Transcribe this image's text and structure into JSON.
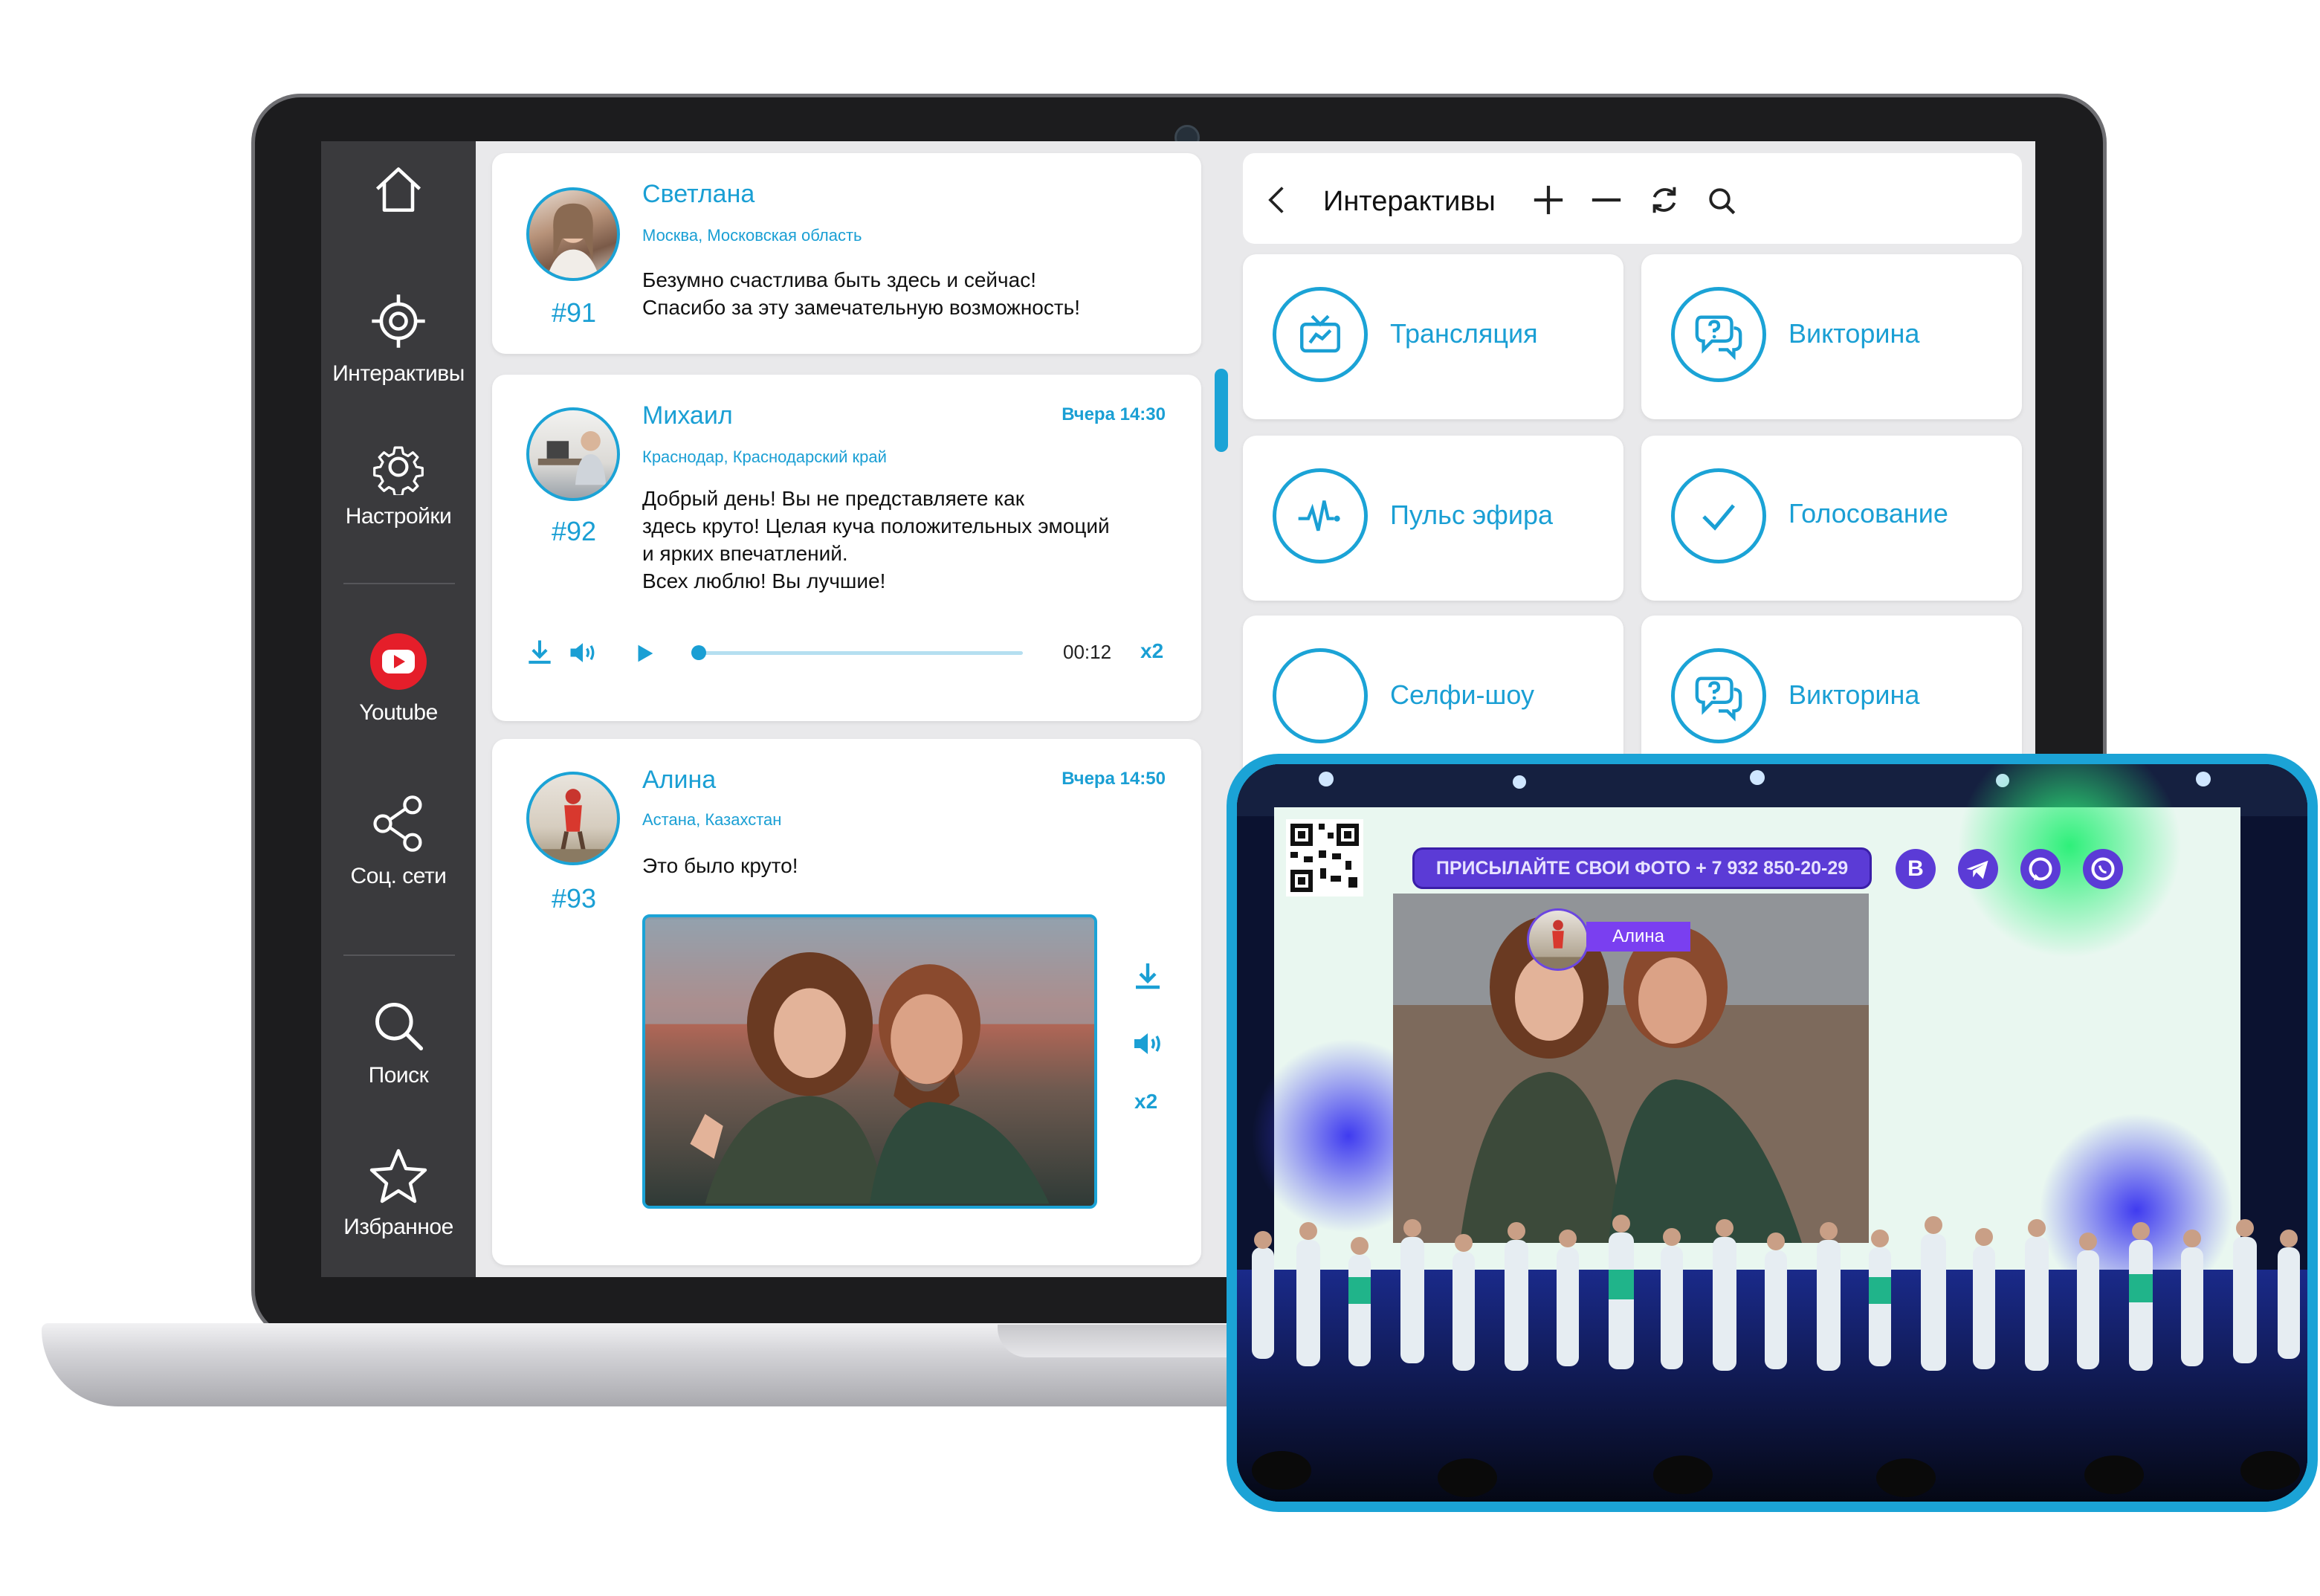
{
  "sidebar": {
    "items": [
      {
        "label": "",
        "icon": "home-icon"
      },
      {
        "label": "Интерактивы",
        "icon": "target-icon"
      },
      {
        "label": "Настройки",
        "icon": "gear-icon"
      },
      {
        "label": "Youtube",
        "icon": "youtube-icon"
      },
      {
        "label": "Соц. сети",
        "icon": "share-icon"
      },
      {
        "label": "Поиск",
        "icon": "search-icon"
      },
      {
        "label": "Избранное",
        "icon": "star-icon"
      }
    ]
  },
  "feed": {
    "posts": [
      {
        "name": "Светлана",
        "location": "Москва, Московская область",
        "number": "#91",
        "time": "",
        "text": "Безумно счастлива быть здесь и сейчас!\nСпасибо за эту замечательную возможность!"
      },
      {
        "name": "Михаил",
        "location": "Краснодар, Краснодарский край",
        "number": "#92",
        "time": "Вчера 14:30",
        "text": "Добрый день! Вы не представляете как\nздесь круто!  Целая куча положительных эмоций\nи ярких впечатлений.\n Всех люблю! Вы лучшие!",
        "audio": {
          "time": "00:12",
          "speed": "x2",
          "progress": 0.0
        }
      },
      {
        "name": "Алина",
        "location": "Астана, Казахстан",
        "number": "#93",
        "time": "Вчера 14:50",
        "text": "Это было круто!",
        "speed": "x2"
      }
    ]
  },
  "interactives": {
    "title": "Интерактивы",
    "tiles": [
      {
        "label": "Трансляция",
        "icon": "broadcast-tv-icon"
      },
      {
        "label": "Викторина",
        "icon": "quiz-chat-icon"
      },
      {
        "label": "Пульс эфира",
        "icon": "pulse-icon"
      },
      {
        "label": "Голосование",
        "icon": "check-vote-icon"
      },
      {
        "label": "Селфи-шоу",
        "icon": "selfie-icon"
      },
      {
        "label": "Викторина",
        "icon": "quiz-chat-icon"
      }
    ]
  },
  "stage": {
    "banner": "ПРИСЫЛАЙТЕ СВОИ ФОТО + 7 932 850-20-29",
    "photo_author": "Алина",
    "social_icons": [
      "vk-icon",
      "telegram-icon",
      "viber-icon",
      "whatsapp-icon"
    ],
    "social_vk_letter": "В"
  },
  "colors": {
    "accent": "#1ba3d6",
    "sidebar": "#3a3a3d",
    "banner": "#5b3bd6",
    "youtube": "#e51e2a"
  }
}
